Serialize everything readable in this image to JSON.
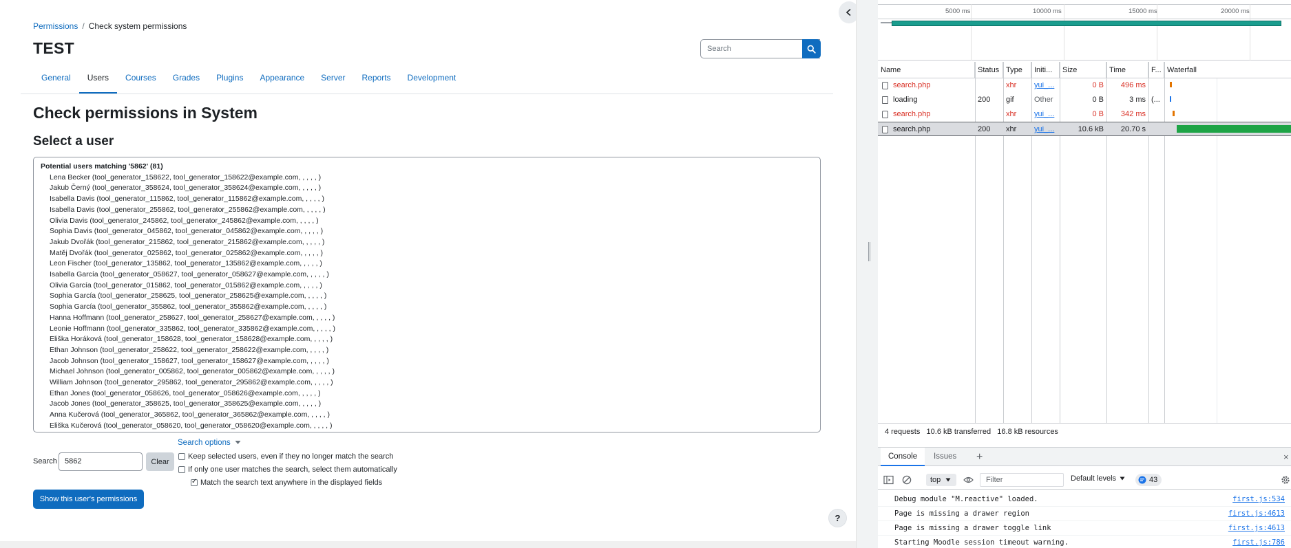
{
  "moodle": {
    "breadcrumb": {
      "root": "Permissions",
      "separator": "/",
      "current": "Check system permissions"
    },
    "page_title": "TEST",
    "header_search": {
      "placeholder": "Search"
    },
    "tabs": [
      {
        "label": "General",
        "active": false
      },
      {
        "label": "Users",
        "active": true
      },
      {
        "label": "Courses",
        "active": false
      },
      {
        "label": "Grades",
        "active": false
      },
      {
        "label": "Plugins",
        "active": false
      },
      {
        "label": "Appearance",
        "active": false
      },
      {
        "label": "Server",
        "active": false
      },
      {
        "label": "Reports",
        "active": false
      },
      {
        "label": "Development",
        "active": false
      }
    ],
    "heading": "Check permissions in System",
    "subheading": "Select a user",
    "user_list": {
      "group_label": "Potential users matching '5862' (81)",
      "options": [
        "Lena Becker (tool_generator_158622, tool_generator_158622@example.com, , , , , )",
        "Jakub Černý (tool_generator_358624, tool_generator_358624@example.com, , , , , )",
        "Isabella Davis (tool_generator_115862, tool_generator_115862@example.com, , , , , )",
        "Isabella Davis (tool_generator_255862, tool_generator_255862@example.com, , , , , )",
        "Olivia Davis (tool_generator_245862, tool_generator_245862@example.com, , , , , )",
        "Sophia Davis (tool_generator_045862, tool_generator_045862@example.com, , , , , )",
        "Jakub Dvořák (tool_generator_215862, tool_generator_215862@example.com, , , , , )",
        "Matěj Dvořák (tool_generator_025862, tool_generator_025862@example.com, , , , , )",
        "Leon Fischer (tool_generator_135862, tool_generator_135862@example.com, , , , , )",
        "Isabella García (tool_generator_058627, tool_generator_058627@example.com, , , , , )",
        "Olivia García (tool_generator_015862, tool_generator_015862@example.com, , , , , )",
        "Sophia García (tool_generator_258625, tool_generator_258625@example.com, , , , , )",
        "Sophia García (tool_generator_355862, tool_generator_355862@example.com, , , , , )",
        "Hanna Hoffmann (tool_generator_258627, tool_generator_258627@example.com, , , , , )",
        "Leonie Hoffmann (tool_generator_335862, tool_generator_335862@example.com, , , , , )",
        "Eliška Horáková (tool_generator_158628, tool_generator_158628@example.com, , , , , )",
        "Ethan Johnson (tool_generator_258622, tool_generator_258622@example.com, , , , , )",
        "Jacob Johnson (tool_generator_158627, tool_generator_158627@example.com, , , , , )",
        "Michael Johnson (tool_generator_005862, tool_generator_005862@example.com, , , , , )",
        "William Johnson (tool_generator_295862, tool_generator_295862@example.com, , , , , )",
        "Ethan Jones (tool_generator_058626, tool_generator_058626@example.com, , , , , )",
        "Jacob Jones (tool_generator_358625, tool_generator_358625@example.com, , , , , )",
        "Anna Kučerová (tool_generator_365862, tool_generator_365862@example.com, , , , , )",
        "Eliška Kučerová (tool_generator_058620, tool_generator_058620@example.com, , , , , )"
      ]
    },
    "search_options_label": "Search options",
    "search_label": "Search",
    "search_value": "5862",
    "clear_label": "Clear",
    "checkboxes": [
      {
        "label": "Keep selected users, even if they no longer match the search",
        "checked": false
      },
      {
        "label": "If only one user matches the search, select them automatically",
        "checked": false
      },
      {
        "label": "Match the search text anywhere in the displayed fields",
        "checked": true
      }
    ],
    "show_button": "Show this user's permissions",
    "help_label": "?"
  },
  "devtools": {
    "overview_ticks": [
      "5000 ms",
      "10000 ms",
      "15000 ms",
      "20000 ms"
    ],
    "columns": [
      "Name",
      "Status",
      "Type",
      "Initi...",
      "Size",
      "Time",
      "F...",
      "Waterfall"
    ],
    "requests": [
      {
        "name": "search.php",
        "status": "",
        "type": "xhr",
        "initiator": "yui_...",
        "size": "0 B",
        "time": "496 ms",
        "fulfilled": "",
        "error": true,
        "icon": "xhr-icon"
      },
      {
        "name": "loading",
        "status": "200",
        "type": "gif",
        "initiator": "Other",
        "size": "0 B",
        "time": "3 ms",
        "fulfilled": "(...",
        "error": false,
        "icon": "document-icon"
      },
      {
        "name": "search.php",
        "status": "",
        "type": "xhr",
        "initiator": "yui_...",
        "size": "0 B",
        "time": "342 ms",
        "fulfilled": "",
        "error": true,
        "icon": "xhr-icon"
      },
      {
        "name": "search.php",
        "status": "200",
        "type": "xhr",
        "initiator": "yui_...",
        "size": "10.6 kB",
        "time": "20.70 s",
        "fulfilled": "",
        "error": false,
        "icon": "xhr-icon",
        "selected": true
      }
    ],
    "summary": {
      "requests": "4 requests",
      "transferred": "10.6 kB transferred",
      "resources": "16.8 kB resources"
    },
    "drawer_tabs": [
      {
        "label": "Console",
        "active": true
      },
      {
        "label": "Issues",
        "active": false
      }
    ],
    "console": {
      "context": "top",
      "filter_placeholder": "Filter",
      "levels": "Default levels",
      "issues_count": "43",
      "messages": [
        {
          "text": "Debug module \"M.reactive\" loaded.",
          "source": "first.js:534"
        },
        {
          "text": "Page is missing a drawer region",
          "source": "first.js:4613"
        },
        {
          "text": "Page is missing a drawer toggle link",
          "source": "first.js:4613"
        },
        {
          "text": "Starting Moodle session timeout warning.",
          "source": "first.js:786"
        }
      ]
    },
    "colors": {
      "error": "#d93025",
      "link": "#1a73e8",
      "overview_bar": "#1a9d8e",
      "waterfall_ok": "#1ea446"
    }
  }
}
